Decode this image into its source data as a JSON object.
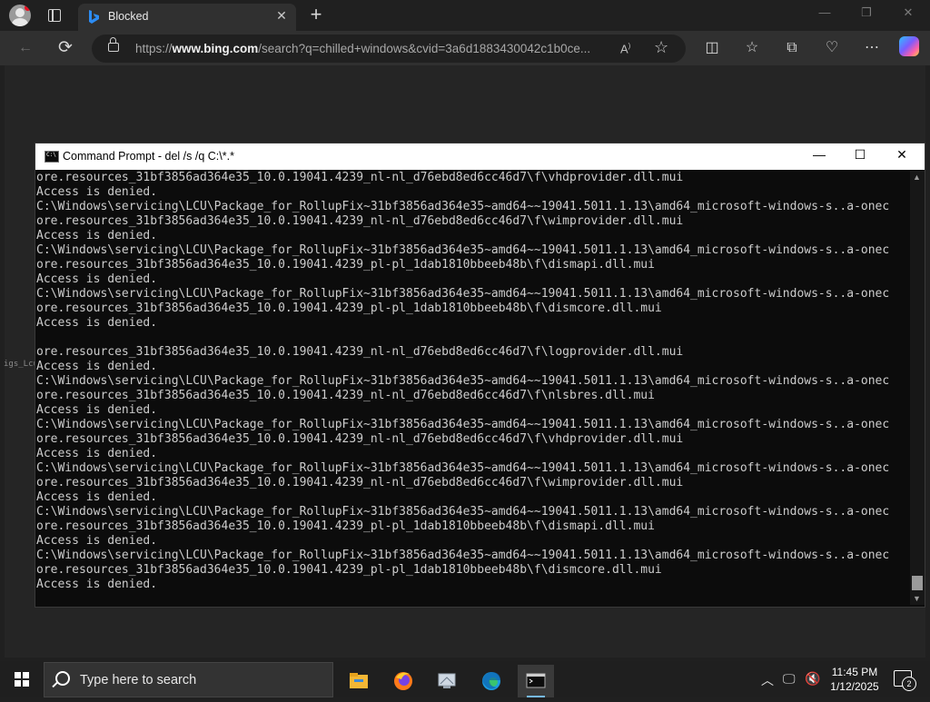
{
  "browser": {
    "tab_title": "Blocked",
    "url_host": "https://www.bing.com",
    "url_path": "/search?q=chilled+windows&cvid=3a6d1883430042c1b0ce...",
    "url_host_plain": "https://",
    "url_host_bold": "www.bing.com",
    "read_aloud_label": "Aͅ",
    "icons": {
      "profile": "profile-avatar-icon",
      "tabs": "tab-actions-icon",
      "new_tab": "plus-icon",
      "back": "back-arrow-icon",
      "refresh": "refresh-icon",
      "favorite": "star-icon",
      "split": "split-screen-icon",
      "favorites": "favorites-icon",
      "collections": "collections-icon",
      "performance": "heart-pulse-icon",
      "more": "more-icon",
      "copilot": "copilot-icon"
    },
    "window_controls": {
      "minimize": "—",
      "restore": "❐",
      "close": "✕"
    }
  },
  "page": {
    "side_fragment": "igs_Lcu"
  },
  "cmd": {
    "title": "Command Prompt - del  /s /q C:\\*.*",
    "controls": {
      "minimize": "—",
      "maximize": "☐",
      "close": "✕"
    },
    "lines": [
      "ore.resources_31bf3856ad364e35_10.0.19041.4239_nl-nl_d76ebd8ed6cc46d7\\f\\vhdprovider.dll.mui",
      "Access is denied.",
      "C:\\Windows\\servicing\\LCU\\Package_for_RollupFix~31bf3856ad364e35~amd64~~19041.5011.1.13\\amd64_microsoft-windows-s..a-onec",
      "ore.resources_31bf3856ad364e35_10.0.19041.4239_nl-nl_d76ebd8ed6cc46d7\\f\\wimprovider.dll.mui",
      "Access is denied.",
      "C:\\Windows\\servicing\\LCU\\Package_for_RollupFix~31bf3856ad364e35~amd64~~19041.5011.1.13\\amd64_microsoft-windows-s..a-onec",
      "ore.resources_31bf3856ad364e35_10.0.19041.4239_pl-pl_1dab1810bbeeb48b\\f\\dismapi.dll.mui",
      "Access is denied.",
      "C:\\Windows\\servicing\\LCU\\Package_for_RollupFix~31bf3856ad364e35~amd64~~19041.5011.1.13\\amd64_microsoft-windows-s..a-onec",
      "ore.resources_31bf3856ad364e35_10.0.19041.4239_pl-pl_1dab1810bbeeb48b\\f\\dismcore.dll.mui",
      "Access is denied.",
      "",
      "ore.resources_31bf3856ad364e35_10.0.19041.4239_nl-nl_d76ebd8ed6cc46d7\\f\\logprovider.dll.mui",
      "Access is denied.",
      "C:\\Windows\\servicing\\LCU\\Package_for_RollupFix~31bf3856ad364e35~amd64~~19041.5011.1.13\\amd64_microsoft-windows-s..a-onec",
      "ore.resources_31bf3856ad364e35_10.0.19041.4239_nl-nl_d76ebd8ed6cc46d7\\f\\nlsbres.dll.mui",
      "Access is denied.",
      "C:\\Windows\\servicing\\LCU\\Package_for_RollupFix~31bf3856ad364e35~amd64~~19041.5011.1.13\\amd64_microsoft-windows-s..a-onec",
      "ore.resources_31bf3856ad364e35_10.0.19041.4239_nl-nl_d76ebd8ed6cc46d7\\f\\vhdprovider.dll.mui",
      "Access is denied.",
      "C:\\Windows\\servicing\\LCU\\Package_for_RollupFix~31bf3856ad364e35~amd64~~19041.5011.1.13\\amd64_microsoft-windows-s..a-onec",
      "ore.resources_31bf3856ad364e35_10.0.19041.4239_nl-nl_d76ebd8ed6cc46d7\\f\\wimprovider.dll.mui",
      "Access is denied.",
      "C:\\Windows\\servicing\\LCU\\Package_for_RollupFix~31bf3856ad364e35~amd64~~19041.5011.1.13\\amd64_microsoft-windows-s..a-onec",
      "ore.resources_31bf3856ad364e35_10.0.19041.4239_pl-pl_1dab1810bbeeb48b\\f\\dismapi.dll.mui",
      "Access is denied.",
      "C:\\Windows\\servicing\\LCU\\Package_for_RollupFix~31bf3856ad364e35~amd64~~19041.5011.1.13\\amd64_microsoft-windows-s..a-onec",
      "ore.resources_31bf3856ad364e35_10.0.19041.4239_pl-pl_1dab1810bbeeb48b\\f\\dismcore.dll.mui",
      "Access is denied."
    ]
  },
  "taskbar": {
    "search_placeholder": "Type here to search",
    "apps": [
      "file-explorer-icon",
      "firefox-icon",
      "remote-desktop-icon",
      "edge-icon",
      "command-prompt-icon"
    ],
    "time": "11:45 PM",
    "date": "1/12/2025",
    "notification_count": "2"
  },
  "colors": {
    "console_bg": "#0c0c0c",
    "console_text": "#cccccc",
    "taskbar_bg": "#1f1f1f",
    "accent": "#76b9ed"
  }
}
